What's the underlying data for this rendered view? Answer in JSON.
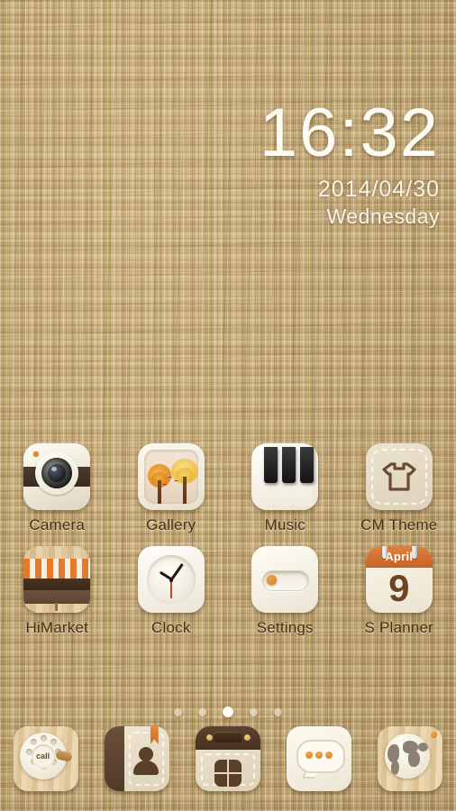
{
  "wallpaper": {
    "style": "woven-linen-fabric",
    "base_color": "#c2a676",
    "light_thread": "#e8d7af",
    "dark_thread": "#a88b5c"
  },
  "clock_widget": {
    "time": "16:32",
    "date": "2014/04/30",
    "weekday": "Wednesday",
    "color": "#fdfaf2"
  },
  "app_grid": {
    "rows": [
      [
        {
          "label": "Camera",
          "icon": "camera-icon"
        },
        {
          "label": "Gallery",
          "icon": "gallery-icon"
        },
        {
          "label": "Music",
          "icon": "music-icon"
        },
        {
          "label": "CM Theme",
          "icon": "cm-theme-icon"
        }
      ],
      [
        {
          "label": "HiMarket",
          "icon": "himarket-icon"
        },
        {
          "label": "Clock",
          "icon": "clock-icon"
        },
        {
          "label": "Settings",
          "icon": "settings-icon"
        },
        {
          "label": "S Planner",
          "icon": "s-planner-icon"
        }
      ]
    ],
    "label_color": "#4a2d16"
  },
  "icon_details": {
    "phone_dial_text": "call",
    "planner_month": "April",
    "planner_day": "9",
    "planner_header_color": "#c86224",
    "accent_orange": "#d8791f"
  },
  "page_indicator": {
    "total": 5,
    "active_index": 2,
    "active_color": "#fffdf5",
    "inactive_color": "rgba(255,252,240,0.45)"
  },
  "dock": {
    "items": [
      {
        "name": "phone",
        "icon": "phone-dial-icon"
      },
      {
        "name": "contacts",
        "icon": "contacts-book-icon"
      },
      {
        "name": "app-drawer",
        "icon": "app-drawer-icon"
      },
      {
        "name": "messages",
        "icon": "speech-bubble-icon"
      },
      {
        "name": "browser",
        "icon": "globe-icon"
      }
    ]
  }
}
